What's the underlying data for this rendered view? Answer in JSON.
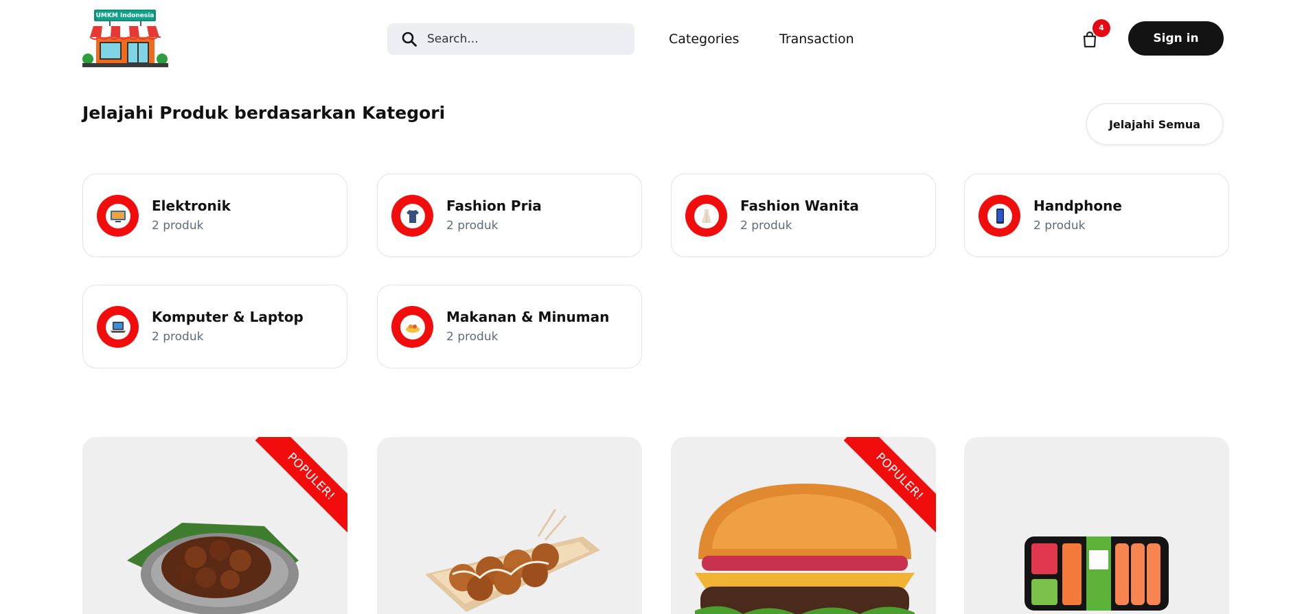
{
  "header": {
    "logo_text": "UMKM Indonesia",
    "search_placeholder": "Search...",
    "nav": [
      {
        "label": "Categories"
      },
      {
        "label": "Transaction"
      }
    ],
    "cart_count": "4",
    "signin_label": "Sign in"
  },
  "section": {
    "title": "Jelajahi Produk berdasarkan Kategori",
    "explore_all_label": "Jelajahi Semua"
  },
  "categories": [
    {
      "name": "Elektronik",
      "count": "2 produk",
      "icon": "electronics-icon"
    },
    {
      "name": "Fashion Pria",
      "count": "2 produk",
      "icon": "tshirt-icon"
    },
    {
      "name": "Fashion Wanita",
      "count": "2 produk",
      "icon": "dress-icon"
    },
    {
      "name": "Handphone",
      "count": "2 produk",
      "icon": "phone-icon"
    },
    {
      "name": "Komputer & Laptop",
      "count": "2 produk",
      "icon": "laptop-icon"
    },
    {
      "name": "Makanan & Minuman",
      "count": "2 produk",
      "icon": "food-icon"
    }
  ],
  "products": [
    {
      "image": "rendang-dish-image",
      "badge": "POPULER!"
    },
    {
      "image": "takoyaki-image",
      "badge": ""
    },
    {
      "image": "burger-image",
      "badge": "POPULER!"
    },
    {
      "image": "sushi-box-image",
      "badge": ""
    }
  ],
  "colors": {
    "accent": "#f20d0d",
    "dark": "#131313",
    "muted": "#5b6b7a",
    "card_bg": "#efefef"
  }
}
